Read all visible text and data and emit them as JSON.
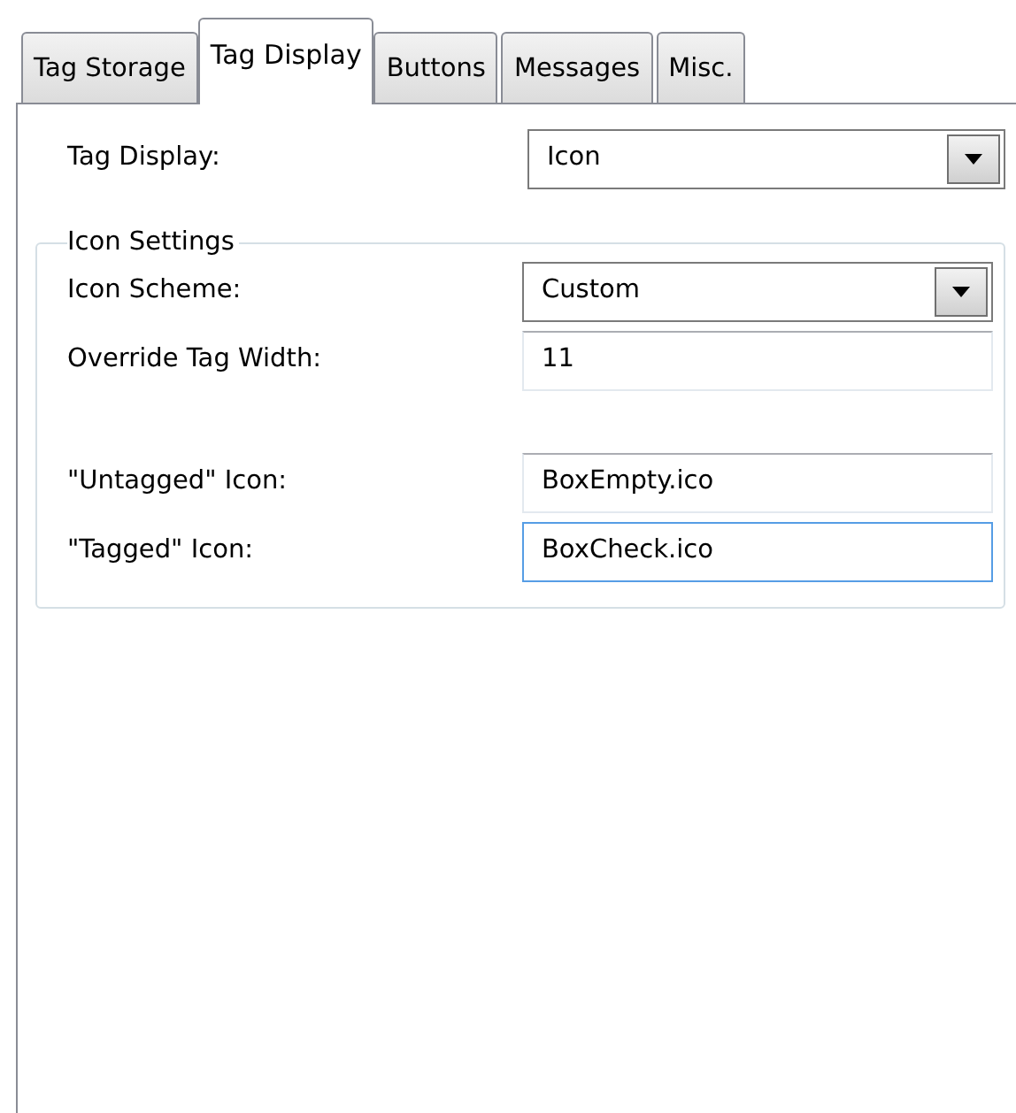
{
  "tabs": [
    {
      "label": "Tag Storage",
      "selected": false
    },
    {
      "label": "Tag Display",
      "selected": true
    },
    {
      "label": "Buttons",
      "selected": false
    },
    {
      "label": "Messages",
      "selected": false
    },
    {
      "label": "Misc.",
      "selected": false
    }
  ],
  "fields": [
    {
      "kind": "dropdown",
      "label": "Tag Display:",
      "value": "Icon",
      "focused": false
    }
  ],
  "icon_settings": {
    "title": "Icon Settings",
    "sections": [
      [
        {
          "kind": "dropdown",
          "label": "Icon Scheme:",
          "value": "Custom",
          "focused": false
        },
        {
          "kind": "text",
          "label": "Override Tag Width:",
          "value": "11",
          "focused": false
        }
      ],
      [
        {
          "kind": "text",
          "label": "\"Untagged\" Icon:",
          "value": "BoxEmpty.ico",
          "focused": false
        },
        {
          "kind": "text",
          "label": "\"Tagged\" Icon:",
          "value": "BoxCheck.ico",
          "focused": true
        }
      ]
    ]
  }
}
